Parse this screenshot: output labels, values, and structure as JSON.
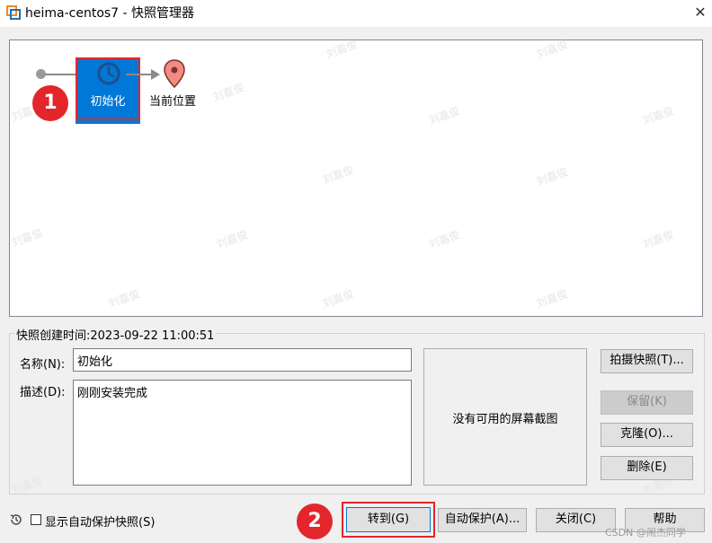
{
  "window": {
    "title": "heima-centos7 - 快照管理器",
    "close_glyph": "✕"
  },
  "tree": {
    "snapshot_name": "初始化",
    "current_position_label": "当前位置",
    "step_badge_1": "1"
  },
  "details": {
    "created_label": "快照创建时间:2023-09-22 11:00:51",
    "name_label": "名称(N):",
    "name_value": "初始化",
    "description_label": "描述(D):",
    "description_value": "刚刚安装完成",
    "screenshot_placeholder": "没有可用的屏幕截图"
  },
  "side_buttons": {
    "take_snapshot": "拍摄快照(T)...",
    "keep": "保留(K)",
    "clone": "克隆(O)...",
    "delete": "删除(E)"
  },
  "footer": {
    "show_autoprotect_label": "显示自动保护快照(S)",
    "step_badge_2": "2",
    "goto": "转到(G)",
    "autoprotect": "自动保护(A)...",
    "close": "关闭(C)",
    "help": "帮助"
  },
  "watermark_text": "刘嘉俊",
  "csdn_credit": "CSDN @闹杰同学",
  "colors": {
    "selection": "#0078d7",
    "highlight_red": "#e2262b",
    "badge_red": "#e3262b",
    "pin_fill": "#f28b82"
  }
}
